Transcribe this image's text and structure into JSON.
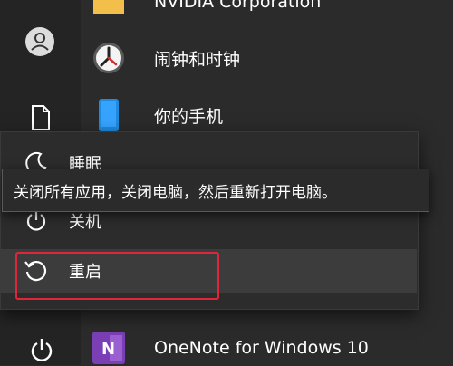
{
  "apps": [
    {
      "label": "NVIDIA Corporation",
      "icon": "folder-icon"
    },
    {
      "label": "闹钟和时钟",
      "icon": "alarm-clock-icon"
    },
    {
      "label": "你的手机",
      "icon": "phone-icon"
    },
    {
      "label": "OneNote for Windows 10",
      "icon": "onenote-icon",
      "icon_text": "N"
    }
  ],
  "power_menu": {
    "sleep_label": "睡眠",
    "shutdown_label": "关机",
    "restart_label": "重启"
  },
  "tooltip": "关闭所有应用，关闭电脑，然后重新打开电脑。",
  "colors": {
    "highlight": "#e0263a",
    "onenote": "#7b3fb5",
    "folder": "#f2c04a"
  }
}
